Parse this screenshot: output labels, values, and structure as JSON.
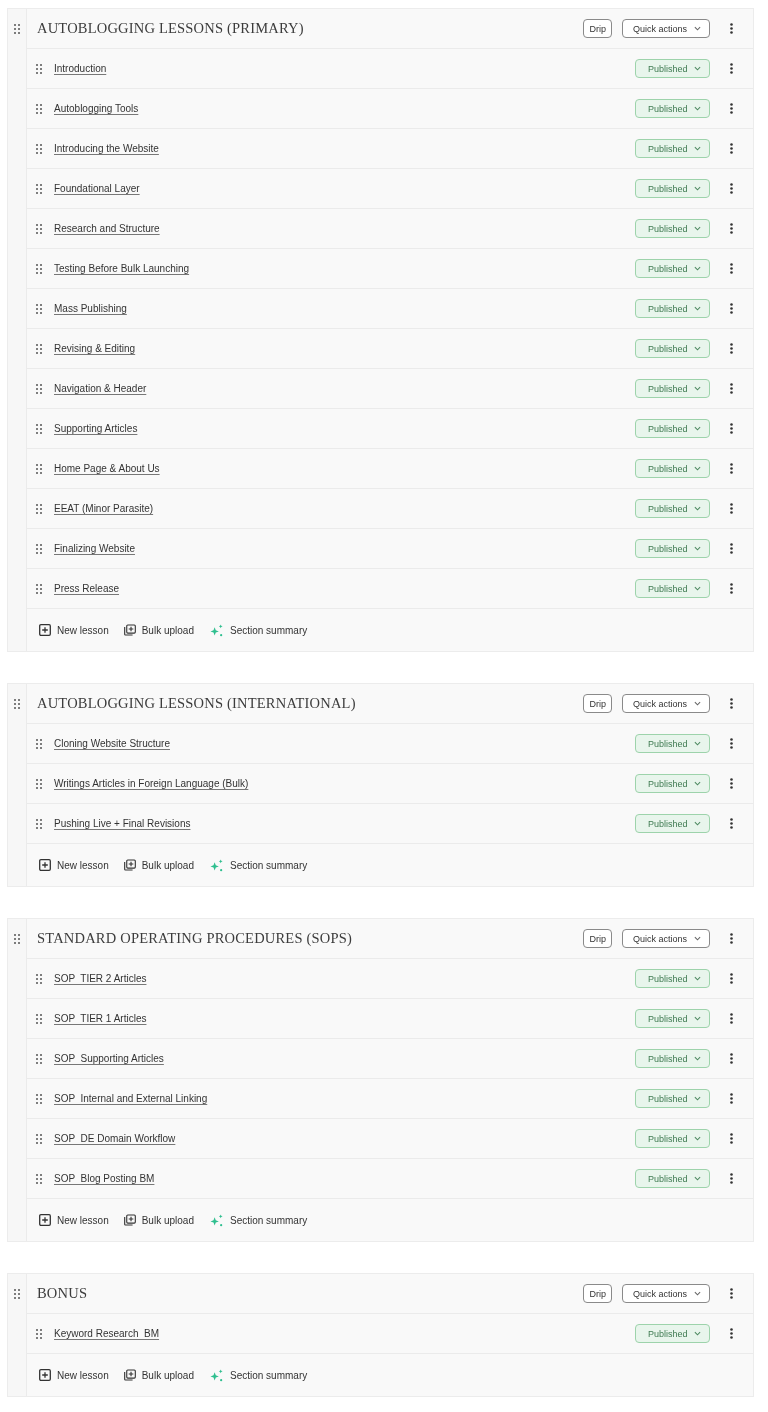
{
  "sections": [
    {
      "title": "AUTOBLOGGING LESSONS (PRIMARY)",
      "drip": "Drip",
      "quick_actions": "Quick actions",
      "lessons": [
        {
          "title": "Introduction",
          "status": "Published"
        },
        {
          "title": "Autoblogging Tools",
          "status": "Published"
        },
        {
          "title": "Introducing the Website",
          "status": "Published"
        },
        {
          "title": "Foundational Layer",
          "status": "Published"
        },
        {
          "title": "Research and Structure",
          "status": "Published"
        },
        {
          "title": "Testing Before Bulk Launching",
          "status": "Published"
        },
        {
          "title": "Mass Publishing",
          "status": "Published"
        },
        {
          "title": "Revising & Editing",
          "status": "Published"
        },
        {
          "title": "Navigation & Header",
          "status": "Published"
        },
        {
          "title": "Supporting Articles",
          "status": "Published"
        },
        {
          "title": "Home Page & About Us",
          "status": "Published"
        },
        {
          "title": "EEAT (Minor Parasite)",
          "status": "Published"
        },
        {
          "title": "Finalizing Website",
          "status": "Published"
        },
        {
          "title": "Press Release",
          "status": "Published"
        }
      ],
      "footer_actions": [
        {
          "kind": "new",
          "label": "New lesson"
        },
        {
          "kind": "bulk",
          "label": "Bulk upload"
        },
        {
          "kind": "summary",
          "label": "Section summary"
        }
      ]
    },
    {
      "title": "AUTOBLOGGING LESSONS (INTERNATIONAL)",
      "drip": "Drip",
      "quick_actions": "Quick actions",
      "lessons": [
        {
          "title": "Cloning Website Structure",
          "status": "Published"
        },
        {
          "title": "Writings Articles in Foreign Language (Bulk)",
          "status": "Published"
        },
        {
          "title": "Pushing Live + Final Revisions",
          "status": "Published"
        }
      ],
      "footer_actions": [
        {
          "kind": "new",
          "label": "New lesson"
        },
        {
          "kind": "bulk",
          "label": "Bulk upload"
        },
        {
          "kind": "summary",
          "label": "Section summary"
        }
      ]
    },
    {
      "title": "STANDARD OPERATING PROCEDURES (SOPS)",
      "drip": "Drip",
      "quick_actions": "Quick actions",
      "lessons": [
        {
          "title": "SOP  TIER 2 Articles",
          "status": "Published"
        },
        {
          "title": "SOP  TIER 1 Articles",
          "status": "Published"
        },
        {
          "title": "SOP  Supporting Articles",
          "status": "Published"
        },
        {
          "title": "SOP  Internal and External Linking",
          "status": "Published"
        },
        {
          "title": "SOP  DE Domain Workflow",
          "status": "Published"
        },
        {
          "title": "SOP  Blog Posting BM",
          "status": "Published"
        }
      ],
      "footer_actions": [
        {
          "kind": "new",
          "label": "New lesson"
        },
        {
          "kind": "bulk",
          "label": "Bulk upload"
        },
        {
          "kind": "summary",
          "label": "Section summary"
        }
      ]
    },
    {
      "title": "BONUS",
      "drip": "Drip",
      "quick_actions": "Quick actions",
      "lessons": [
        {
          "title": "Keyword Research  BM",
          "status": "Published"
        }
      ],
      "footer_actions": [
        {
          "kind": "new",
          "label": "New lesson"
        },
        {
          "kind": "bulk",
          "label": "Bulk upload"
        },
        {
          "kind": "summary",
          "label": "Section summary"
        }
      ]
    }
  ]
}
